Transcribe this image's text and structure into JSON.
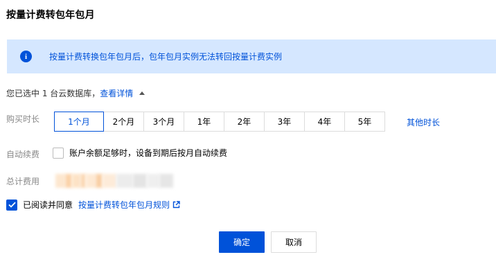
{
  "dialog": {
    "title": "按量计费转包年包月"
  },
  "notice": {
    "icon": "info-icon",
    "text": "按量计费转换包年包月后，包年包月实例无法转回按量计费实例"
  },
  "selection": {
    "text": "您已选中 1 台云数据库，",
    "details_link": "查看详情",
    "caret_icon": "caret-up-icon"
  },
  "purchase_duration": {
    "label": "购买时长",
    "options": [
      "1个月",
      "2个月",
      "3个月",
      "1年",
      "2年",
      "3年",
      "4年",
      "5年"
    ],
    "selected": "1个月",
    "other_link": "其他时长"
  },
  "auto_renew": {
    "label": "自动续费",
    "checked": false,
    "text": "账户余额足够时，设备到期后按月自动续费"
  },
  "total_cost": {
    "label": "总计费用"
  },
  "agreement": {
    "checked": true,
    "text": "已阅读并同意",
    "link": "按量计费转包年包月规则"
  },
  "buttons": {
    "confirm": "确定",
    "cancel": "取消"
  },
  "colors": {
    "accent": "#0052d9",
    "notice_bg": "#d5e7ff"
  }
}
